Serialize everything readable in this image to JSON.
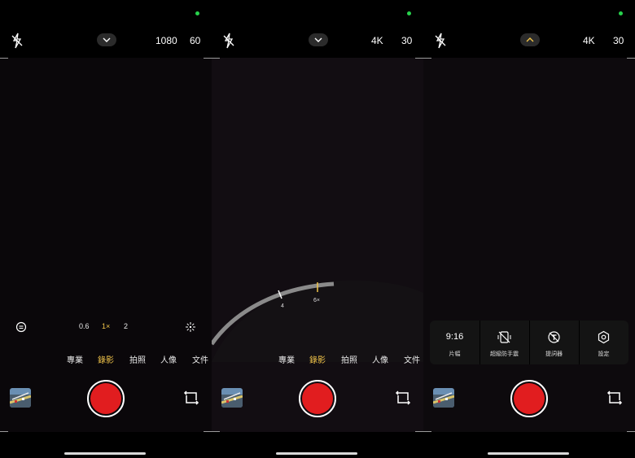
{
  "panels": [
    {
      "resolution": "1080",
      "fps": "60",
      "modes": [
        "專業",
        "錄影",
        "拍照",
        "人像",
        "文件"
      ],
      "active_mode": "錄影",
      "zoom_levels": [
        "0.6",
        "1×",
        "2"
      ]
    },
    {
      "resolution": "4K",
      "fps": "30",
      "modes": [
        "專業",
        "錄影",
        "拍照",
        "人像",
        "文件"
      ],
      "active_mode": "錄影",
      "zoom_dial": {
        "tick_4": "4",
        "tick_6": "6×"
      }
    },
    {
      "resolution": "4K",
      "fps": "30",
      "quick_settings": [
        {
          "value": "9:16",
          "label": "片幅"
        },
        {
          "icon": "stabilization-icon",
          "label": "超級防手震"
        },
        {
          "icon": "teleprompter-icon",
          "label": "提詞器"
        },
        {
          "icon": "settings-icon",
          "label": "設定"
        }
      ]
    }
  ],
  "colors": {
    "accent": "#f2c54a",
    "record": "#e11d1f",
    "status_dot": "#27d24c"
  }
}
